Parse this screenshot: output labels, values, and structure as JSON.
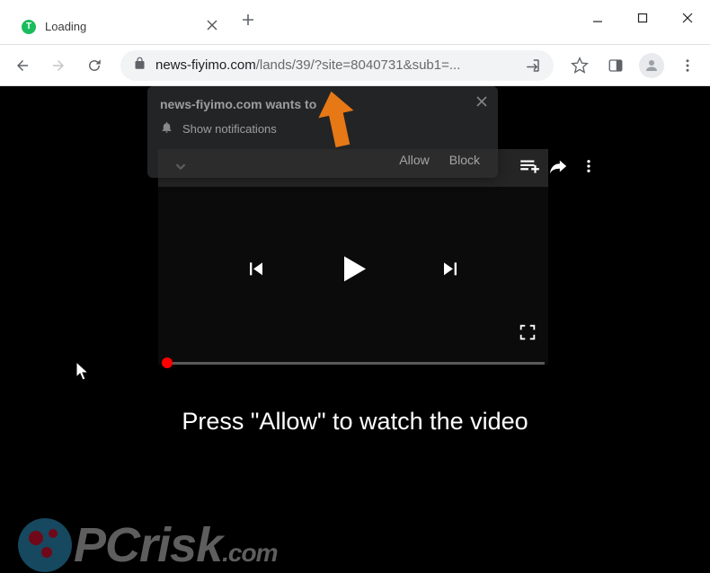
{
  "window": {
    "tab_title": "Loading",
    "tab_favicon_letter": "T"
  },
  "url": {
    "host": "news-fiyimo.com",
    "path": "/lands/39/?site=8040731&sub1=..."
  },
  "notification": {
    "origin_prefix": "news-fiyimo.com",
    "wants_to": " wants to",
    "show_label": "Show notifications",
    "allow": "Allow",
    "block": "Block"
  },
  "page_text": {
    "press_allow": "Press \"Allow\" to watch the video"
  },
  "icons": {
    "back": "back-icon",
    "forward": "forward-icon",
    "reload": "reload-icon",
    "lock": "lock-icon",
    "share_url": "share-url-icon",
    "star": "star-icon",
    "side_panel": "side-panel-icon",
    "profile": "profile-icon",
    "minimize": "minimize-icon",
    "maximize": "maximize-icon",
    "close_win": "close-window-icon",
    "new_tab": "new-tab-icon",
    "close_tab": "close-tab-icon",
    "bell": "bell-icon",
    "up_arrow": "collapse-icon",
    "playlist_add": "playlist-add-icon",
    "share": "share-icon",
    "kebab": "kebab-icon",
    "prev": "previous-icon",
    "play": "play-icon",
    "next": "next-icon",
    "fullscreen": "fullscreen-icon",
    "pointer_arrow": "arrow-pointer-icon",
    "cursor": "cursor-icon"
  },
  "watermark": {
    "text_main": "PCrisk",
    "text_small": ".com"
  }
}
